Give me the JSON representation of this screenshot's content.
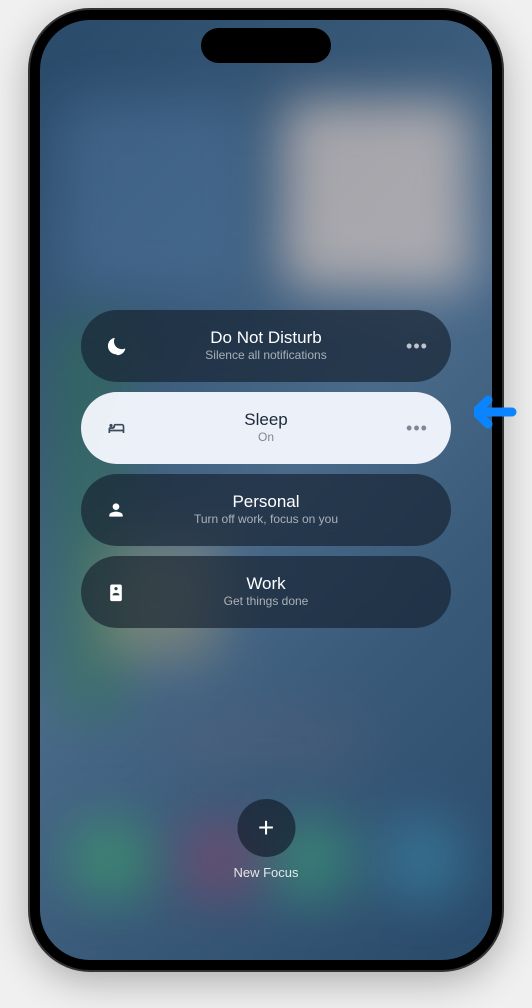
{
  "focus_modes": [
    {
      "id": "dnd",
      "title": "Do Not Disturb",
      "subtitle": "Silence all notifications",
      "icon": "moon",
      "active": false
    },
    {
      "id": "sleep",
      "title": "Sleep",
      "subtitle": "On",
      "icon": "bed",
      "active": true
    },
    {
      "id": "personal",
      "title": "Personal",
      "subtitle": "Turn off work, focus on you",
      "icon": "person",
      "active": false
    },
    {
      "id": "work",
      "title": "Work",
      "subtitle": "Get things done",
      "icon": "badge",
      "active": false
    }
  ],
  "new_focus_label": "New Focus"
}
